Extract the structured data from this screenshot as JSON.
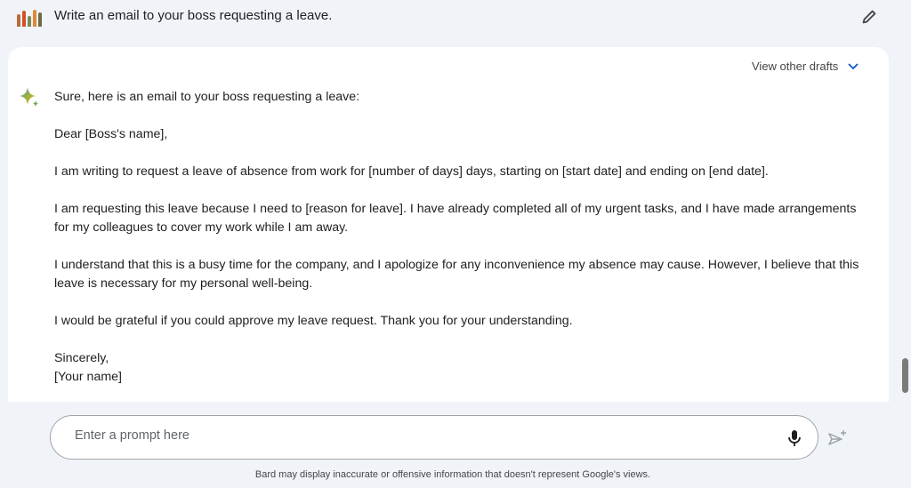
{
  "user_prompt": "Write an email to your boss requesting a leave.",
  "drafts_label": "View other drafts",
  "response": {
    "intro": "Sure, here is an email to your boss requesting a leave:",
    "paragraphs": [
      "Dear [Boss's name],",
      "I am writing to request a leave of absence from work for [number of days] days, starting on [start date] and ending on [end date].",
      "I am requesting this leave because I need to [reason for leave]. I have already completed all of my urgent tasks, and I have made arrangements for my colleagues to cover my work while I am away.",
      "I understand that this is a busy time for the company, and I apologize for any inconvenience my absence may cause. However, I believe that this leave is necessary for my personal well-being.",
      "I would be grateful if you could approve my leave request. Thank you for your understanding."
    ],
    "closing": "Sincerely,",
    "signature": "[Your name]"
  },
  "input": {
    "placeholder": "Enter a prompt here",
    "value": ""
  },
  "disclaimer": "Bard may display inaccurate or offensive information that doesn't represent Google's views.",
  "colors": {
    "background": "#f0f4f9",
    "accent": "#0b57d0"
  }
}
